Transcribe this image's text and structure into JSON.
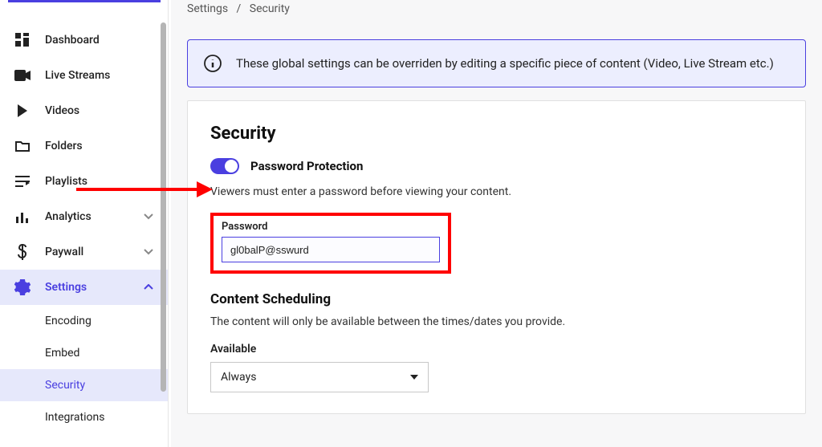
{
  "sidebar": {
    "items": [
      {
        "label": "Dashboard",
        "icon": "dashboard-icon"
      },
      {
        "label": "Live Streams",
        "icon": "camera-icon"
      },
      {
        "label": "Videos",
        "icon": "play-icon"
      },
      {
        "label": "Folders",
        "icon": "folder-icon"
      },
      {
        "label": "Playlists",
        "icon": "playlist-icon"
      },
      {
        "label": "Analytics",
        "icon": "bar-chart-icon",
        "expandable": true
      },
      {
        "label": "Paywall",
        "icon": "dollar-icon",
        "expandable": true
      },
      {
        "label": "Settings",
        "icon": "gear-icon",
        "expandable": true,
        "active": true
      }
    ],
    "settings_subitems": [
      {
        "label": "Encoding"
      },
      {
        "label": "Embed"
      },
      {
        "label": "Security",
        "active": true
      },
      {
        "label": "Integrations"
      }
    ]
  },
  "breadcrumb": {
    "crumb1": "Settings",
    "separator": "/",
    "crumb2": "Security"
  },
  "banner": {
    "text": "These global settings can be overriden by editing a specific piece of content (Video, Live Stream etc.)"
  },
  "security": {
    "heading": "Security",
    "password_protection": {
      "label": "Password Protection",
      "help": "Viewers must enter a password before viewing your content.",
      "field_label": "Password",
      "value": "gl0balP@sswurd",
      "enabled": true
    },
    "content_scheduling": {
      "heading": "Content Scheduling",
      "help": "The content will only be available between the times/dates you provide.",
      "available_label": "Available",
      "available_value": "Always"
    }
  },
  "colors": {
    "accent": "#4a3fe0",
    "highlight": "#ff0000"
  }
}
